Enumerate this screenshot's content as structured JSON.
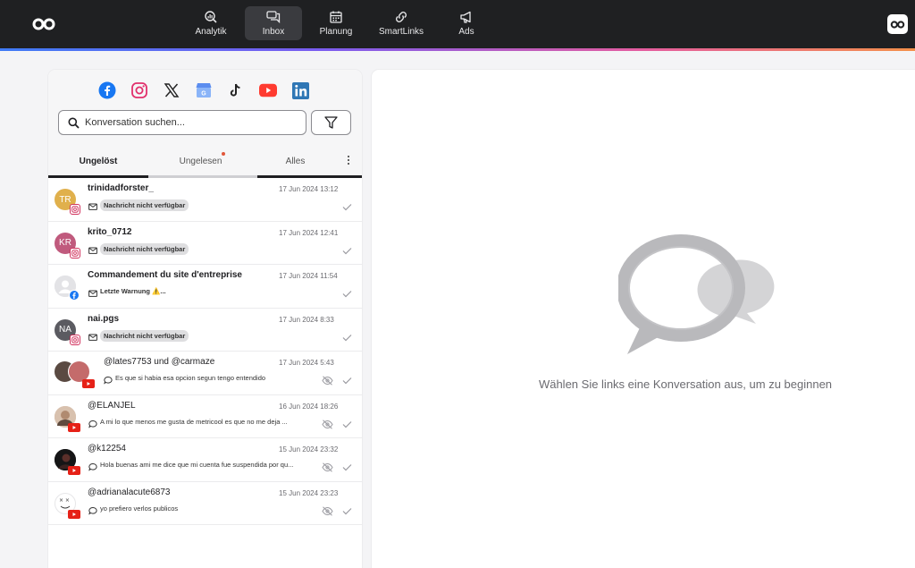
{
  "nav": {
    "items": [
      {
        "label": "Analytik",
        "icon": "analytics-icon"
      },
      {
        "label": "Inbox",
        "icon": "inbox-icon",
        "active": true
      },
      {
        "label": "Planung",
        "icon": "calendar-icon"
      },
      {
        "label": "SmartLinks",
        "icon": "link-icon"
      },
      {
        "label": "Ads",
        "icon": "megaphone-icon"
      }
    ]
  },
  "networks": [
    "facebook-icon",
    "instagram-icon",
    "x-icon",
    "google-business-icon",
    "tiktok-icon",
    "youtube-icon",
    "linkedin-icon"
  ],
  "search": {
    "placeholder": "Konversation suchen..."
  },
  "tabs": {
    "unresolved": "Ungelöst",
    "unread": "Ungelesen",
    "all": "Alles"
  },
  "conversations": [
    {
      "name": "trinidadforster_",
      "initials": "TR",
      "avatar_color": "#e0b04c",
      "network": "instagram",
      "date": "17 Jun 2024 13:12",
      "preview": "Nachricht nicht verfügbar"
    },
    {
      "name": "krito_0712",
      "initials": "KR",
      "avatar_color": "#c05a7d",
      "network": "instagram",
      "date": "17 Jun 2024 12:41",
      "preview": "Nachricht nicht verfügbar"
    },
    {
      "name": "Commandement du site d'entreprise",
      "initials": "",
      "avatar_color": "#e3e3e6",
      "network": "facebook",
      "date": "17 Jun 2024 11:54",
      "preview": "Letzte Warnung ⚠️..."
    },
    {
      "name": "nai.pgs",
      "initials": "NA",
      "avatar_color": "#5b5b61",
      "network": "instagram",
      "date": "17 Jun 2024 8:33",
      "preview": "Nachricht nicht verfügbar"
    },
    {
      "name": "@lates7753 und @carmaze",
      "network": "youtube",
      "date": "17 Jun 2024 5:43",
      "preview": "Es que si habia esa opcion segun tengo entendido"
    },
    {
      "name": "@ELANJEL",
      "network": "youtube",
      "date": "16 Jun 2024 18:26",
      "preview": "A mi lo que menos me gusta de metricool es que no me deja ..."
    },
    {
      "name": "@k12254",
      "network": "youtube",
      "date": "15 Jun 2024 23:32",
      "preview": "Hola buenas ami me dice que mi cuenta fue suspendida por qu..."
    },
    {
      "name": "@adrianalacute6873",
      "network": "youtube",
      "date": "15 Jun 2024 23:23",
      "preview": "yo prefiero verlos publicos"
    }
  ],
  "empty_state": {
    "text": "Wählen Sie links eine Konversation aus, um zu beginnen"
  }
}
